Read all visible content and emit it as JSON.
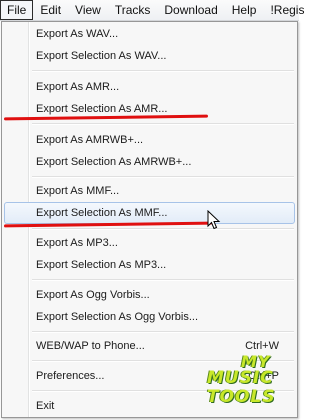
{
  "menubar": {
    "items": [
      "File",
      "Edit",
      "View",
      "Tracks",
      "Download",
      "Help",
      "!Regis"
    ]
  },
  "menu": {
    "export_wav": "Export As WAV...",
    "export_sel_wav": "Export Selection As WAV...",
    "export_amr": "Export As AMR...",
    "export_sel_amr": "Export Selection As AMR...",
    "export_amrwb": "Export As AMRWB+...",
    "export_sel_amrwb": "Export Selection As AMRWB+...",
    "export_mmf": "Export As MMF...",
    "export_sel_mmf": "Export Selection As MMF...",
    "export_mp3": "Export As MP3...",
    "export_sel_mp3": "Export Selection As MP3...",
    "export_ogg": "Export As Ogg Vorbis...",
    "export_sel_ogg": "Export Selection As Ogg Vorbis...",
    "web_wap": "WEB/WAP to Phone...",
    "web_wap_shortcut": "Ctrl+W",
    "preferences": "Preferences...",
    "preferences_shortcut": "Ctrl+P",
    "exit": "Exit"
  },
  "watermark": {
    "line1": "MY",
    "line2": "MUSIC",
    "line3": "TOOLS"
  },
  "colors": {
    "annotation": "#e01010",
    "highlight_border": "#a7c3e8",
    "logo": "#c8e82a"
  }
}
